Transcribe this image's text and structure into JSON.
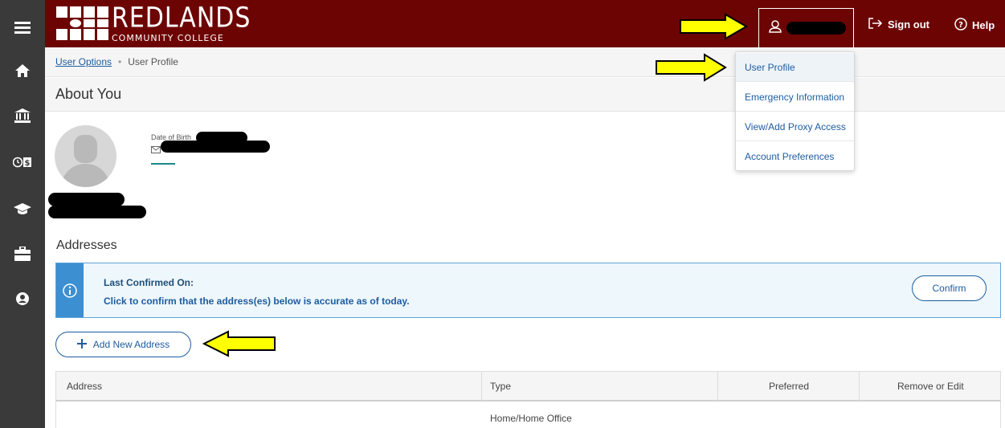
{
  "header": {
    "logo_main": "REDLANDS",
    "logo_sub": "COMMUNITY COLLEGE",
    "sign_out_label": "Sign out",
    "help_label": "Help"
  },
  "breadcrumb": {
    "parent": "User Options",
    "current": "User Profile"
  },
  "page": {
    "section_title": "About You"
  },
  "profile": {
    "dob_label": "Date of Birth"
  },
  "addresses": {
    "title": "Addresses",
    "alert_title": "Last Confirmed On:",
    "alert_text": "Click to confirm that the address(es) below is accurate as of today.",
    "confirm_label": "Confirm",
    "add_label": "Add New Address",
    "columns": [
      "Address",
      "Type",
      "Preferred",
      "Remove or Edit"
    ],
    "rows": [
      {
        "type": "Home/Home Office"
      }
    ]
  },
  "user_menu": {
    "items": [
      "User Profile",
      "Emergency Information",
      "View/Add Proxy Access",
      "Account Preferences"
    ]
  },
  "sidebar": {
    "icons": [
      "menu-icon",
      "home-icon",
      "bank-icon",
      "finance-icon",
      "graduation-cap-icon",
      "briefcase-icon",
      "user-circle-icon"
    ]
  },
  "colors": {
    "brand": "#6d0404",
    "sidebar": "#3a3a3a",
    "link": "#1d5c9f",
    "alert_accent": "#3c8fd1",
    "annotation_arrow": "#ffff00"
  }
}
